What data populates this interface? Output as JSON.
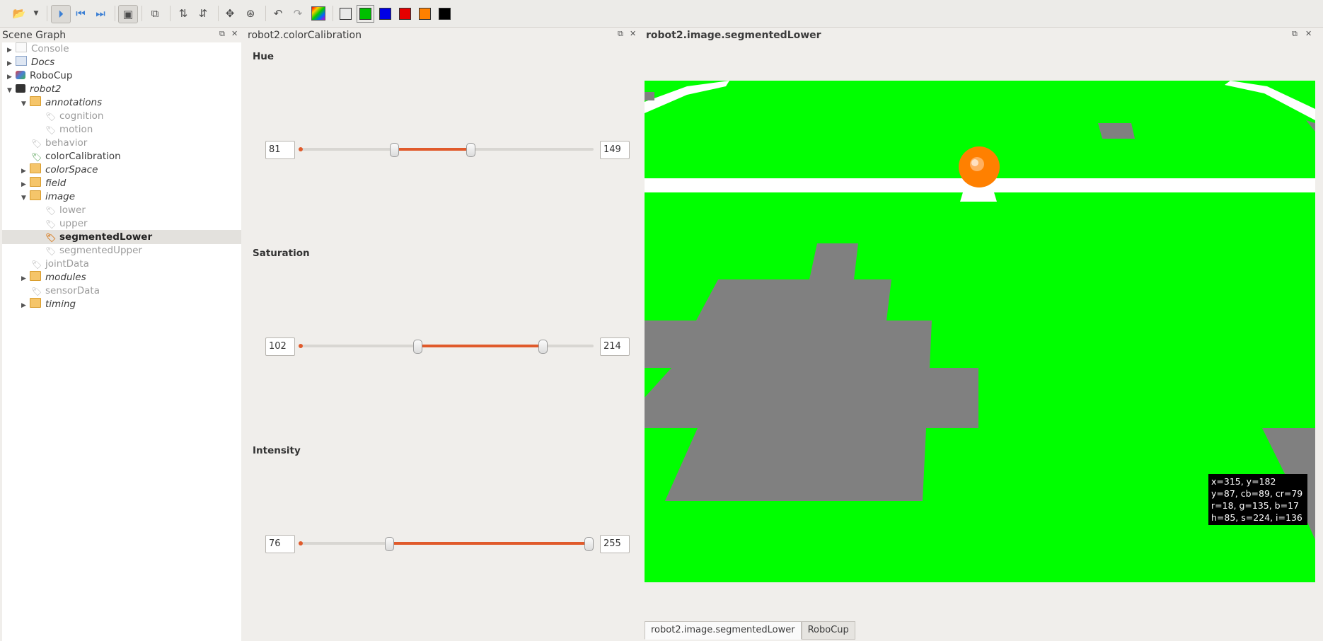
{
  "toolbar": {
    "colors": [
      "#e8e8e8",
      "#00c000",
      "#0000e6",
      "#e60000",
      "#ff8000",
      "#000000"
    ],
    "selected_color": "#00c000"
  },
  "panels": {
    "scene_graph_title": "Scene Graph",
    "calibration_title": "robot2.colorCalibration",
    "image_title": "robot2.image.segmentedLower"
  },
  "tree": {
    "console": "Console",
    "docs": "Docs",
    "robocup": "RoboCup",
    "robot2": "robot2",
    "annotations": "annotations",
    "cognition": "cognition",
    "motion": "motion",
    "behavior": "behavior",
    "colorCalibration": "colorCalibration",
    "colorSpace": "colorSpace",
    "field": "field",
    "image": "image",
    "lower": "lower",
    "upper": "upper",
    "segmentedLower": "segmentedLower",
    "segmentedUpper": "segmentedUpper",
    "jointData": "jointData",
    "modules": "modules",
    "sensorData": "sensorData",
    "timing": "timing"
  },
  "calibration": {
    "hue": {
      "label": "Hue",
      "min": "81",
      "max": "149",
      "scale_max": 255
    },
    "saturation": {
      "label": "Saturation",
      "min": "102",
      "max": "214",
      "scale_max": 255
    },
    "intensity": {
      "label": "Intensity",
      "min": "76",
      "max": "255",
      "scale_max": 255
    }
  },
  "tooltip": {
    "line1": "x=315, y=182",
    "line2": "y=87, cb=89, cr=79",
    "line3": "r=18, g=135, b=17",
    "line4": "h=85, s=224, i=136"
  },
  "tabs": {
    "tab1": "robot2.image.segmentedLower",
    "tab2": "RoboCup"
  }
}
